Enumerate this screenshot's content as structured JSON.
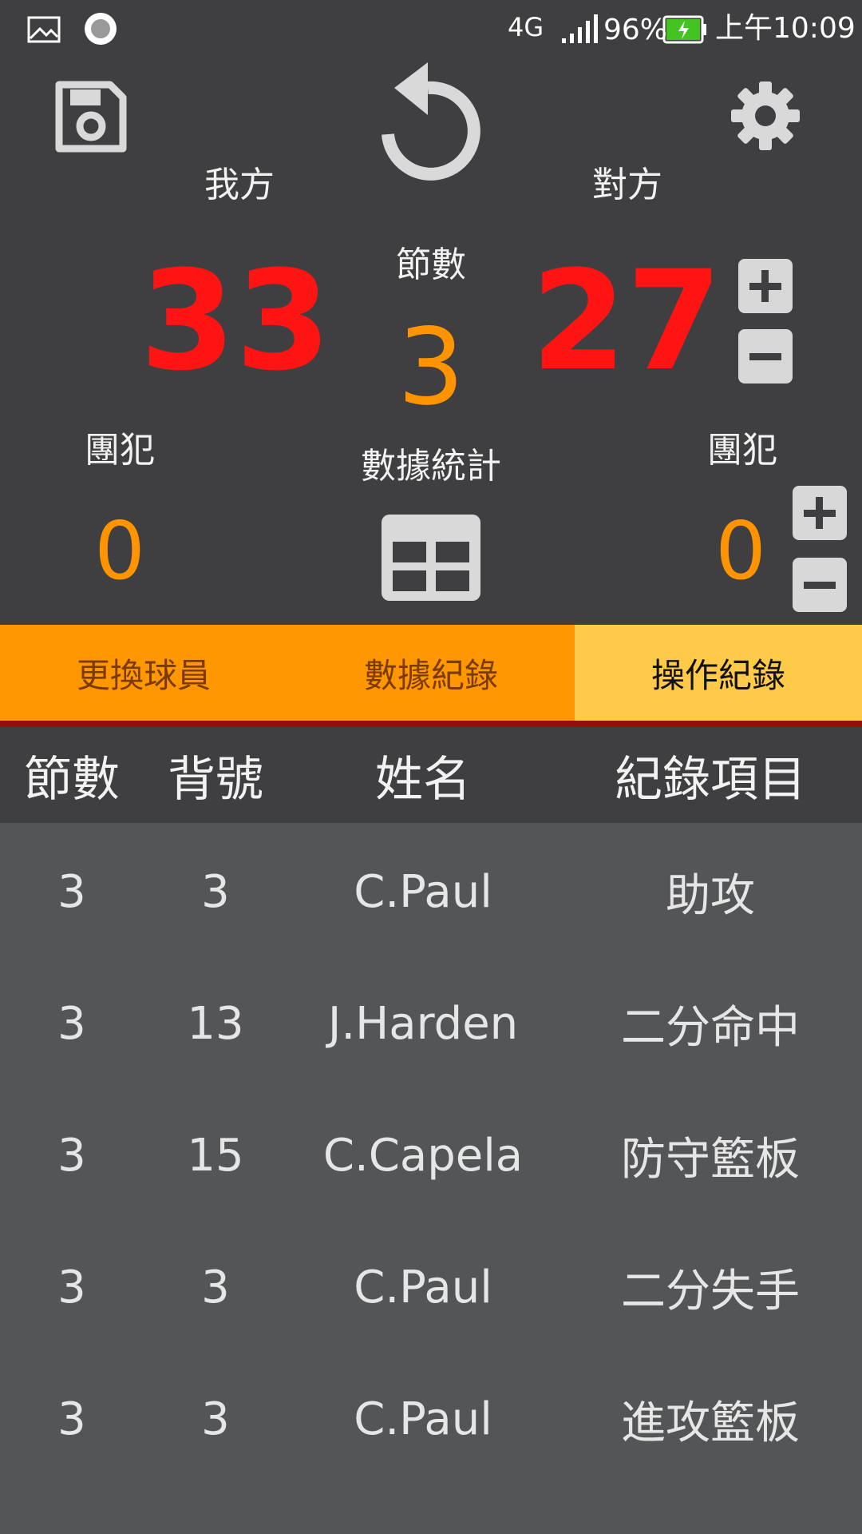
{
  "status_bar": {
    "network": "4G",
    "battery": "96%",
    "time": "上午10:09"
  },
  "toolbar": {
    "save_icon": "save-icon",
    "undo_icon": "undo-icon",
    "settings_icon": "gear-icon"
  },
  "scoreboard": {
    "home_label": "我方",
    "away_label": "對方",
    "period_label": "節數",
    "home_score": "33",
    "away_score": "27",
    "period": "3",
    "home_fouls_label": "團犯",
    "away_fouls_label": "團犯",
    "home_fouls": "0",
    "away_fouls": "0",
    "stats_label": "數據統計"
  },
  "tabs": [
    {
      "label": "更換球員",
      "active": false
    },
    {
      "label": "數據紀錄",
      "active": false
    },
    {
      "label": "操作紀錄",
      "active": true
    }
  ],
  "table": {
    "headers": [
      "節數",
      "背號",
      "姓名",
      "紀錄項目"
    ],
    "rows": [
      {
        "period": "3",
        "number": "3",
        "name": "C.Paul",
        "item": "助攻"
      },
      {
        "period": "3",
        "number": "13",
        "name": "J.Harden",
        "item": "二分命中"
      },
      {
        "period": "3",
        "number": "15",
        "name": "C.Capela",
        "item": "防守籃板"
      },
      {
        "period": "3",
        "number": "3",
        "name": "C.Paul",
        "item": "二分失手"
      },
      {
        "period": "3",
        "number": "3",
        "name": "C.Paul",
        "item": "進攻籃板"
      }
    ]
  },
  "colors": {
    "score": "#ff1414",
    "accent": "#ff9400",
    "tab_inactive": "#ff9800",
    "tab_active": "#ffc94a"
  }
}
